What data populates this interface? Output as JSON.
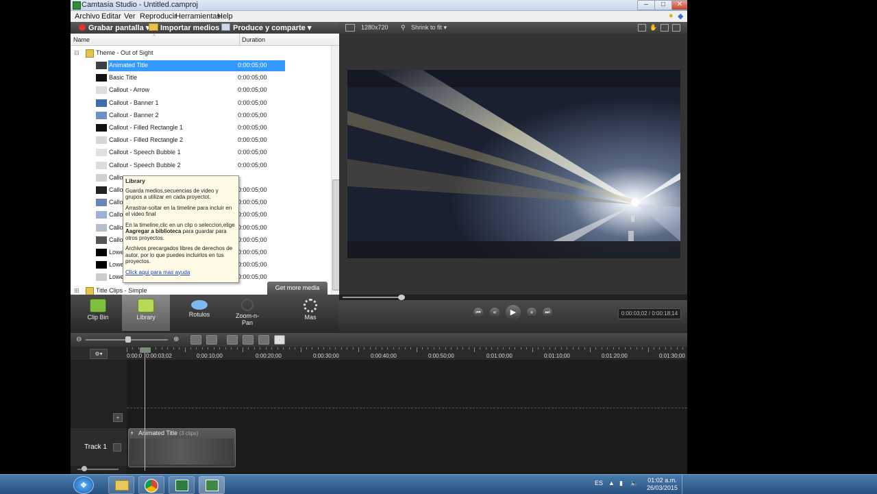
{
  "window": {
    "title": "Camtasia Studio - Untitled.camproj"
  },
  "menu": {
    "items": [
      "Archivo",
      "Editar",
      "Ver",
      "Reproducir",
      "Herramientas",
      "Help"
    ]
  },
  "toolbar": {
    "record": "Grabar pantalla",
    "import": "Importar medios",
    "produce": "Produce y comparte"
  },
  "library": {
    "col_name": "Name",
    "col_duration": "Duration",
    "folder": "Theme - Out of Sight",
    "folder2": "Title Clips - Simple",
    "items": [
      {
        "name": "Animated Title",
        "dur": "0:00:05;00"
      },
      {
        "name": "Basic Title",
        "dur": "0:00:05;00"
      },
      {
        "name": "Callout - Arrow",
        "dur": "0:00:05;00"
      },
      {
        "name": "Callout - Banner 1",
        "dur": "0:00:05;00"
      },
      {
        "name": "Callout - Banner 2",
        "dur": "0:00:05;00"
      },
      {
        "name": "Callout - Filled Rectangle 1",
        "dur": "0:00:05;00"
      },
      {
        "name": "Callout - Filled Rectangle 2",
        "dur": "0:00:05;00"
      },
      {
        "name": "Callout - Speech Bubble 1",
        "dur": "0:00:05;00"
      },
      {
        "name": "Callout - Speech Bubble 2",
        "dur": "0:00:05;00"
      },
      {
        "name": "Callo",
        "dur": ""
      },
      {
        "name": "Callo",
        "dur": "0:00:05;00"
      },
      {
        "name": "Callo",
        "dur": "0:00:05;00"
      },
      {
        "name": "Callo",
        "dur": "0:00:05;00"
      },
      {
        "name": "Callo",
        "dur": "0:00:05;00"
      },
      {
        "name": "Callo",
        "dur": "0:00:05;00"
      },
      {
        "name": "Lowe",
        "dur": "0:00:05;00"
      },
      {
        "name": "Lowe",
        "dur": "0:00:05;00"
      },
      {
        "name": "Lowe",
        "dur": "0:00:05;00"
      }
    ],
    "get_more": "Get more media"
  },
  "tooltip": {
    "title": "Library",
    "p1": "Guarda medios,secuencias de video y grupos a utilizar en cada proyectot.",
    "p2": "Arrastrar-soltar en la timeline para incluir en el video final",
    "p3a": "En la timeline,clic en un clip o seleccion,elige ",
    "p3b": "Aagregar a biblioteca",
    "p3c": " para guardar para otros proyectos.",
    "p4": "Archivos precargados libres de derechos de autor, por lo que puedes incluirlos en tus proyectos.",
    "link": "Click aqui para mas ayuda"
  },
  "tabs": [
    "Clip Bin",
    "Library",
    "Rotulos",
    "Zoom-n-Pan",
    "Mas"
  ],
  "preview": {
    "size": "1280x720",
    "fit": "Shrink to fit",
    "timecode": "0:00:03;02 / 0:00:18;14"
  },
  "timeline": {
    "ticks": [
      "0:00:0",
      "0:00:03;02",
      "0:00:10;00",
      "0:00:20;00",
      "0:00:30;00",
      "0:00:40;00",
      "0:00:50;00",
      "0:01:00;00",
      "0:01:10;00",
      "0:01:20;00",
      "0:01:30;00"
    ],
    "track_label": "Track 1",
    "clip_label": "Animated Title",
    "clip_count": "(3 clips)"
  },
  "taskbar": {
    "lang": "ES",
    "time": "01:02 a.m.",
    "date": "26/03/2015"
  }
}
